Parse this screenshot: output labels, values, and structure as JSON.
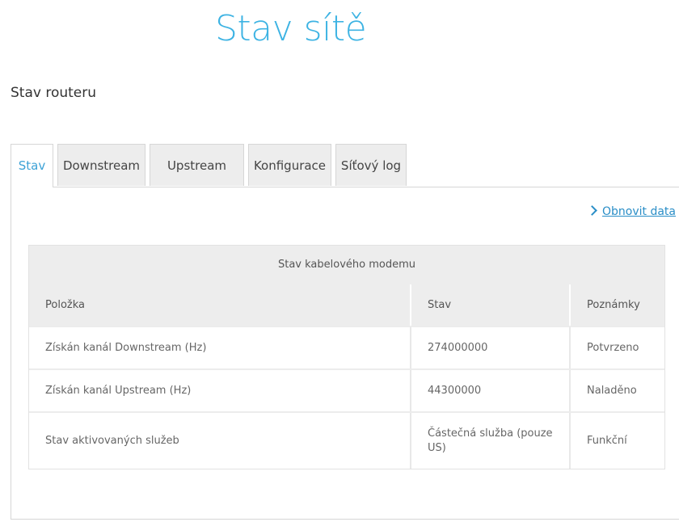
{
  "page": {
    "title": "Stav sítě",
    "section_heading": "Stav routeru"
  },
  "tabs": [
    {
      "label": "Stav",
      "active": true
    },
    {
      "label": "Downstream",
      "active": false
    },
    {
      "label": "Upstream",
      "active": false
    },
    {
      "label": "Konfigurace",
      "active": false
    },
    {
      "label": "Síťový log",
      "active": false
    }
  ],
  "refresh": {
    "label": "Obnovit data",
    "icon": "chevron-right-icon"
  },
  "table": {
    "caption": "Stav kabelového modemu",
    "columns": [
      "Položka",
      "Stav",
      "Poznámky"
    ],
    "rows": [
      {
        "item": "Získán kanál Downstream (Hz)",
        "status": "274000000",
        "note": "Potvrzeno"
      },
      {
        "item": "Získán kanál Upstream (Hz)",
        "status": "44300000",
        "note": "Naladěno"
      },
      {
        "item": "Stav aktivovaných služeb",
        "status": "Částečná služba (pouze US)",
        "note": "Funkční"
      }
    ]
  },
  "colors": {
    "accent": "#3db3e3",
    "link": "#2a8ec7",
    "header_bg": "#ededed",
    "border": "#d6d6d6"
  }
}
